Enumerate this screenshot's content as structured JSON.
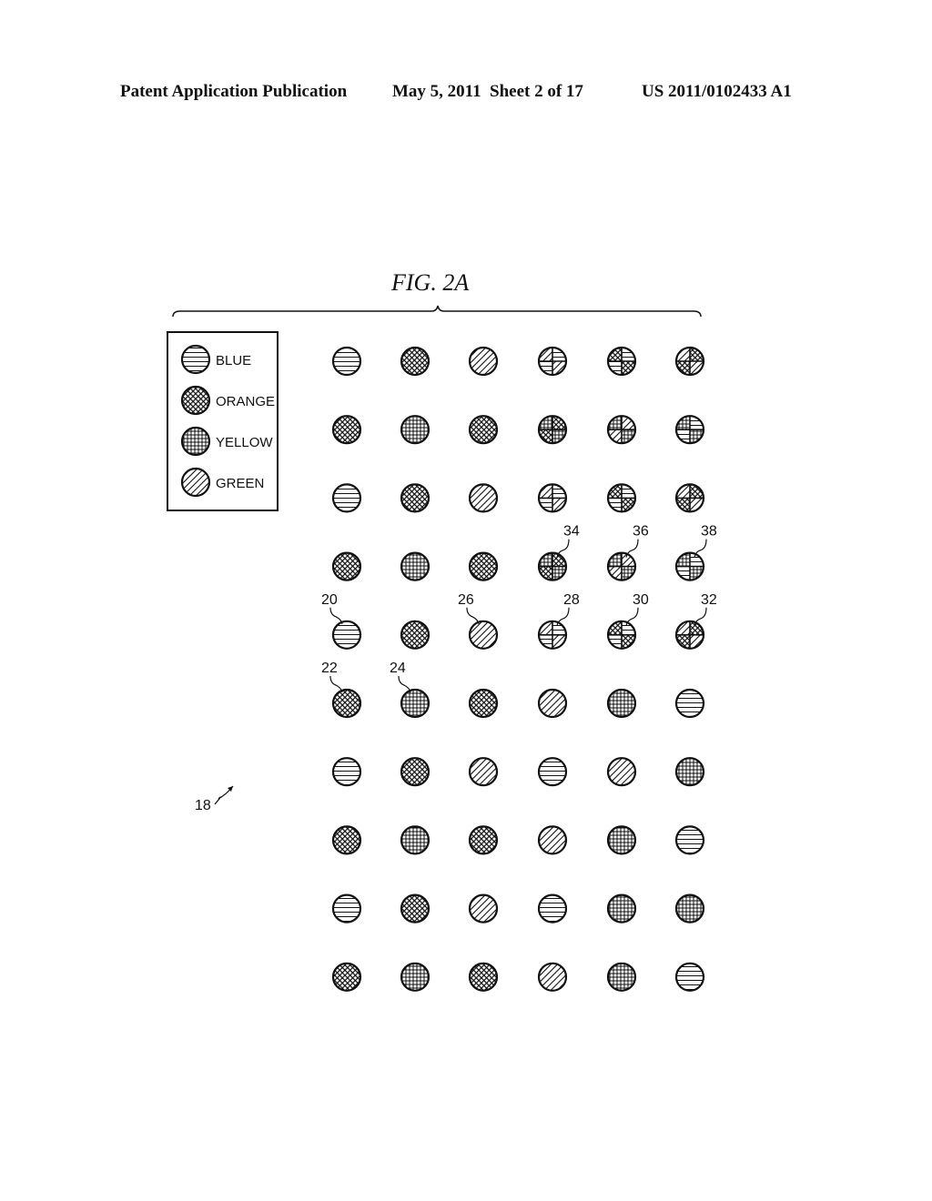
{
  "header": {
    "publication": "Patent Application Publication",
    "date": "May 5, 2011",
    "sheet": "Sheet 2 of 17",
    "number": "US 2011/0102433 A1"
  },
  "figure": {
    "title": "FIG. 2A",
    "array_ref": "18"
  },
  "legend": [
    {
      "color": "BLUE",
      "pattern": "horizontal"
    },
    {
      "color": "ORANGE",
      "pattern": "crosshatch"
    },
    {
      "color": "YELLOW",
      "pattern": "grid"
    },
    {
      "color": "GREEN",
      "pattern": "diagonal"
    }
  ],
  "grid": [
    [
      "B",
      "O",
      "G",
      [
        "G",
        "B",
        "B",
        "G"
      ],
      [
        "O",
        "B",
        "B",
        "O"
      ],
      [
        "G",
        "O",
        "O",
        "G"
      ]
    ],
    [
      "O",
      "Y",
      "O",
      [
        "Y",
        "O",
        "O",
        "Y"
      ],
      [
        "Y",
        "G",
        "G",
        "Y"
      ],
      [
        "Y",
        "B",
        "B",
        "Y"
      ]
    ],
    [
      "B",
      "O",
      "G",
      [
        "G",
        "B",
        "B",
        "G"
      ],
      [
        "O",
        "B",
        "B",
        "O"
      ],
      [
        "G",
        "O",
        "O",
        "G"
      ]
    ],
    [
      "O",
      "Y",
      "O",
      [
        "Y",
        "O",
        "O",
        "Y"
      ],
      [
        "Y",
        "G",
        "G",
        "Y"
      ],
      [
        "Y",
        "B",
        "B",
        "Y"
      ]
    ],
    [
      "B",
      "O",
      "G",
      [
        "G",
        "B",
        "B",
        "G"
      ],
      [
        "O",
        "B",
        "B",
        "O"
      ],
      [
        "G",
        "O",
        "O",
        "G"
      ]
    ],
    [
      "O",
      "Y",
      "O",
      "G",
      "Y",
      "B"
    ],
    [
      "B",
      "O",
      "G",
      "B",
      "G",
      "Y"
    ],
    [
      "O",
      "Y",
      "O",
      "G",
      "Y",
      "B"
    ],
    [
      "B",
      "O",
      "G",
      "B",
      "Y",
      "Y"
    ],
    [
      "O",
      "Y",
      "O",
      "G",
      "Y",
      "B"
    ]
  ],
  "callouts": [
    {
      "label": "34",
      "row": 3,
      "col": 3
    },
    {
      "label": "36",
      "row": 3,
      "col": 4
    },
    {
      "label": "38",
      "row": 3,
      "col": 5
    },
    {
      "label": "20",
      "row": 4,
      "col": 0
    },
    {
      "label": "26",
      "row": 4,
      "col": 2
    },
    {
      "label": "28",
      "row": 4,
      "col": 3
    },
    {
      "label": "30",
      "row": 4,
      "col": 4
    },
    {
      "label": "32",
      "row": 4,
      "col": 5
    },
    {
      "label": "22",
      "row": 5,
      "col": 0
    },
    {
      "label": "24",
      "row": 5,
      "col": 1
    }
  ]
}
